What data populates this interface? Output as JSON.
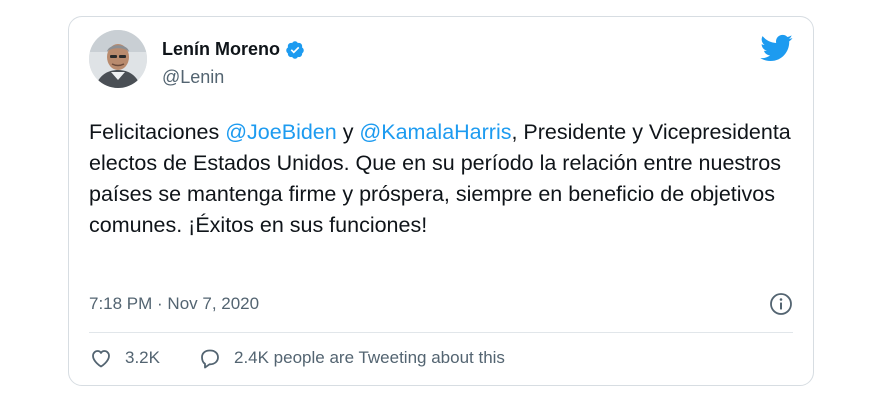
{
  "tweet": {
    "author": {
      "name": "Lenín Moreno",
      "handle": "@Lenin"
    },
    "text": {
      "p1": "Felicitaciones ",
      "m1": "@JoeBiden",
      "p2": " y ",
      "m2": "@KamalaHarris",
      "p3": ", Presidente y Vicepresidenta electos de Estados Unidos. Que en su período la relación entre nuestros países se mantenga firme y próspera, siempre en beneficio de objetivos comunes. ¡Éxitos en sus funciones!"
    },
    "timestamp": "7:18 PM · Nov 7, 2020",
    "likes": "3.2K",
    "replies_text": "2.4K people are Tweeting about this"
  },
  "colors": {
    "link": "#1d9bf0",
    "muted": "#536471",
    "border": "#d7dde2"
  },
  "icons": [
    "avatar",
    "verified-badge-icon",
    "twitter-bird-icon",
    "info-icon",
    "heart-icon",
    "speech-bubble-icon"
  ]
}
